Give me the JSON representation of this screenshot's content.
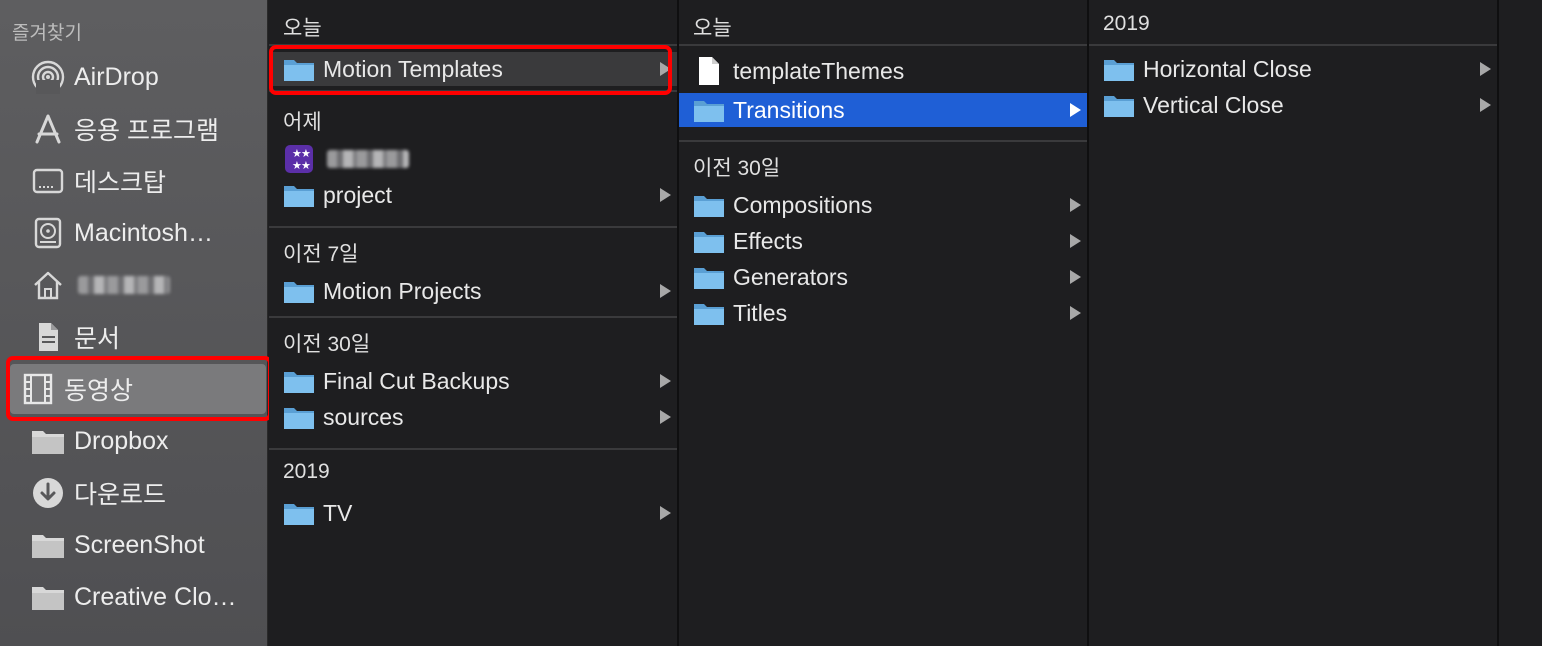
{
  "sidebar": {
    "header": "즐겨찾기",
    "items": [
      {
        "label": "AirDrop",
        "icon": "airdrop-icon"
      },
      {
        "label": "응용 프로그램",
        "icon": "applications-icon"
      },
      {
        "label": "데스크탑",
        "icon": "desktop-icon"
      },
      {
        "label": "Macintosh…",
        "icon": "disk-icon"
      },
      {
        "label": "",
        "icon": "home-icon"
      },
      {
        "label": "문서",
        "icon": "document-icon"
      },
      {
        "label": "동영상",
        "icon": "movie-icon"
      },
      {
        "label": "Dropbox",
        "icon": "folder-icon"
      },
      {
        "label": "다운로드",
        "icon": "download-icon"
      },
      {
        "label": "ScreenShot",
        "icon": "folder-icon"
      },
      {
        "label": "Creative Clo…",
        "icon": "folder-icon"
      }
    ]
  },
  "column1": {
    "sections": [
      {
        "title": "오늘"
      },
      {
        "title": "어제"
      },
      {
        "title": "이전 7일"
      },
      {
        "title": "이전 30일"
      },
      {
        "title": "2019"
      }
    ],
    "items": {
      "motion_templates": "Motion Templates",
      "project": "project",
      "motion_projects": "Motion Projects",
      "final_cut_backups": "Final Cut Backups",
      "sources": "sources",
      "tv": "TV"
    }
  },
  "column2": {
    "sections": [
      {
        "title": "오늘"
      },
      {
        "title": "이전 30일"
      }
    ],
    "items": {
      "template_themes": "templateThemes",
      "transitions": "Transitions",
      "compositions": "Compositions",
      "effects": "Effects",
      "generators": "Generators",
      "titles": "Titles"
    }
  },
  "column3": {
    "sections": [
      {
        "title": "2019"
      }
    ],
    "items": {
      "horizontal_close": "Horizontal Close",
      "vertical_close": "Vertical Close"
    }
  },
  "colors": {
    "sidebar_bg": "#58585a",
    "column_bg": "#1e1e20",
    "selection_blue": "#1f5fd6",
    "selection_grey": "#3a3a3c",
    "folder_blue": "#6fb3e8",
    "highlight_red": "#ff0000"
  }
}
